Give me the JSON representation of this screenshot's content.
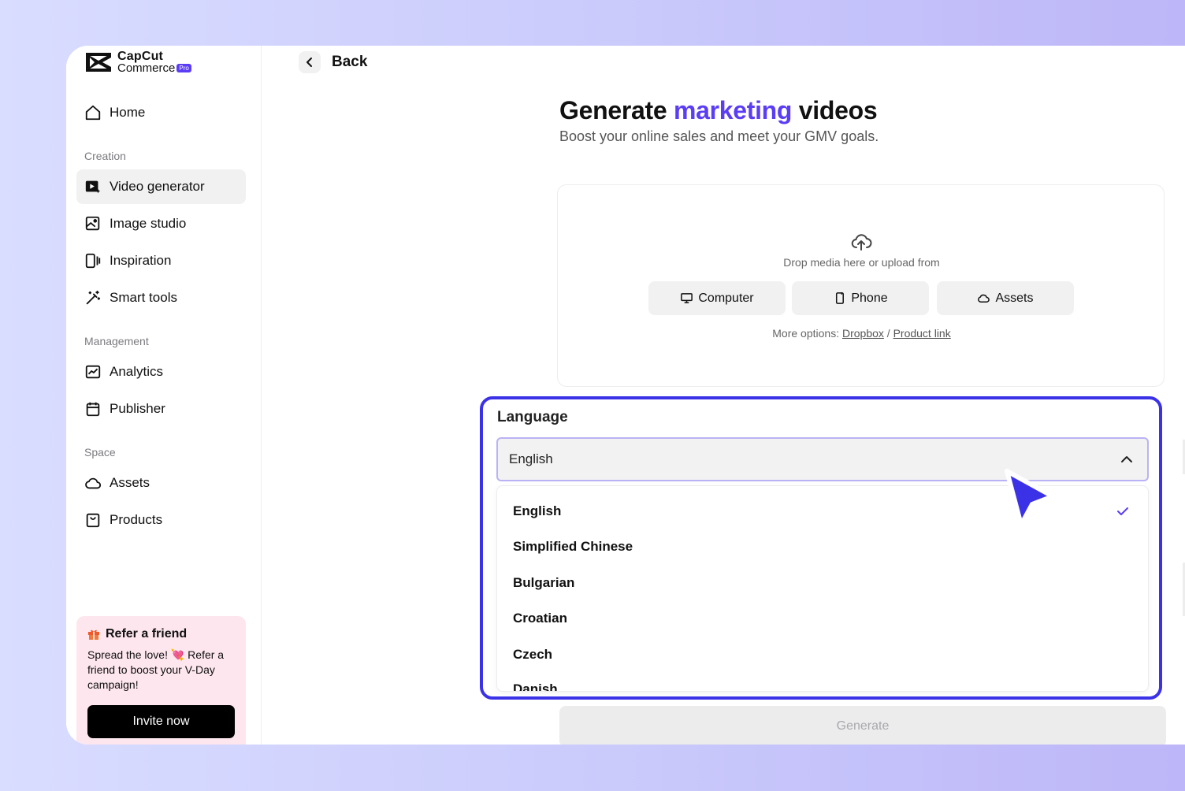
{
  "brand": {
    "line1": "CapCut",
    "line2": "Commerce",
    "badge": "Pro"
  },
  "sidebar": {
    "home": "Home",
    "sections": {
      "creation": "Creation",
      "management": "Management",
      "space": "Space"
    },
    "creation_items": [
      "Video generator",
      "Image studio",
      "Inspiration",
      "Smart tools"
    ],
    "management_items": [
      "Analytics",
      "Publisher"
    ],
    "space_items": [
      "Assets",
      "Products"
    ]
  },
  "refer": {
    "title": "Refer a friend",
    "text": "Spread the love! 💘 Refer a friend to boost your V-Day campaign!",
    "button": "Invite now"
  },
  "header": {
    "back_label": "Back"
  },
  "hero": {
    "title_before": "Generate ",
    "title_accent": "marketing",
    "title_after": " videos",
    "subtitle": "Boost your online sales and meet your GMV goals."
  },
  "upload": {
    "drop_text": "Drop media here or upload from",
    "sources": [
      "Computer",
      "Phone",
      "Assets"
    ],
    "more_prefix": "More options: ",
    "dropbox": "Dropbox",
    "separator": " / ",
    "product_link": "Product link"
  },
  "language": {
    "title": "Language",
    "selected": "English",
    "options": [
      "English",
      "Simplified Chinese",
      "Bulgarian",
      "Croatian",
      "Czech",
      "Danish"
    ]
  },
  "generate_label": "Generate",
  "colors": {
    "accent": "#5b3df5",
    "highlight": "#3b32e8"
  }
}
